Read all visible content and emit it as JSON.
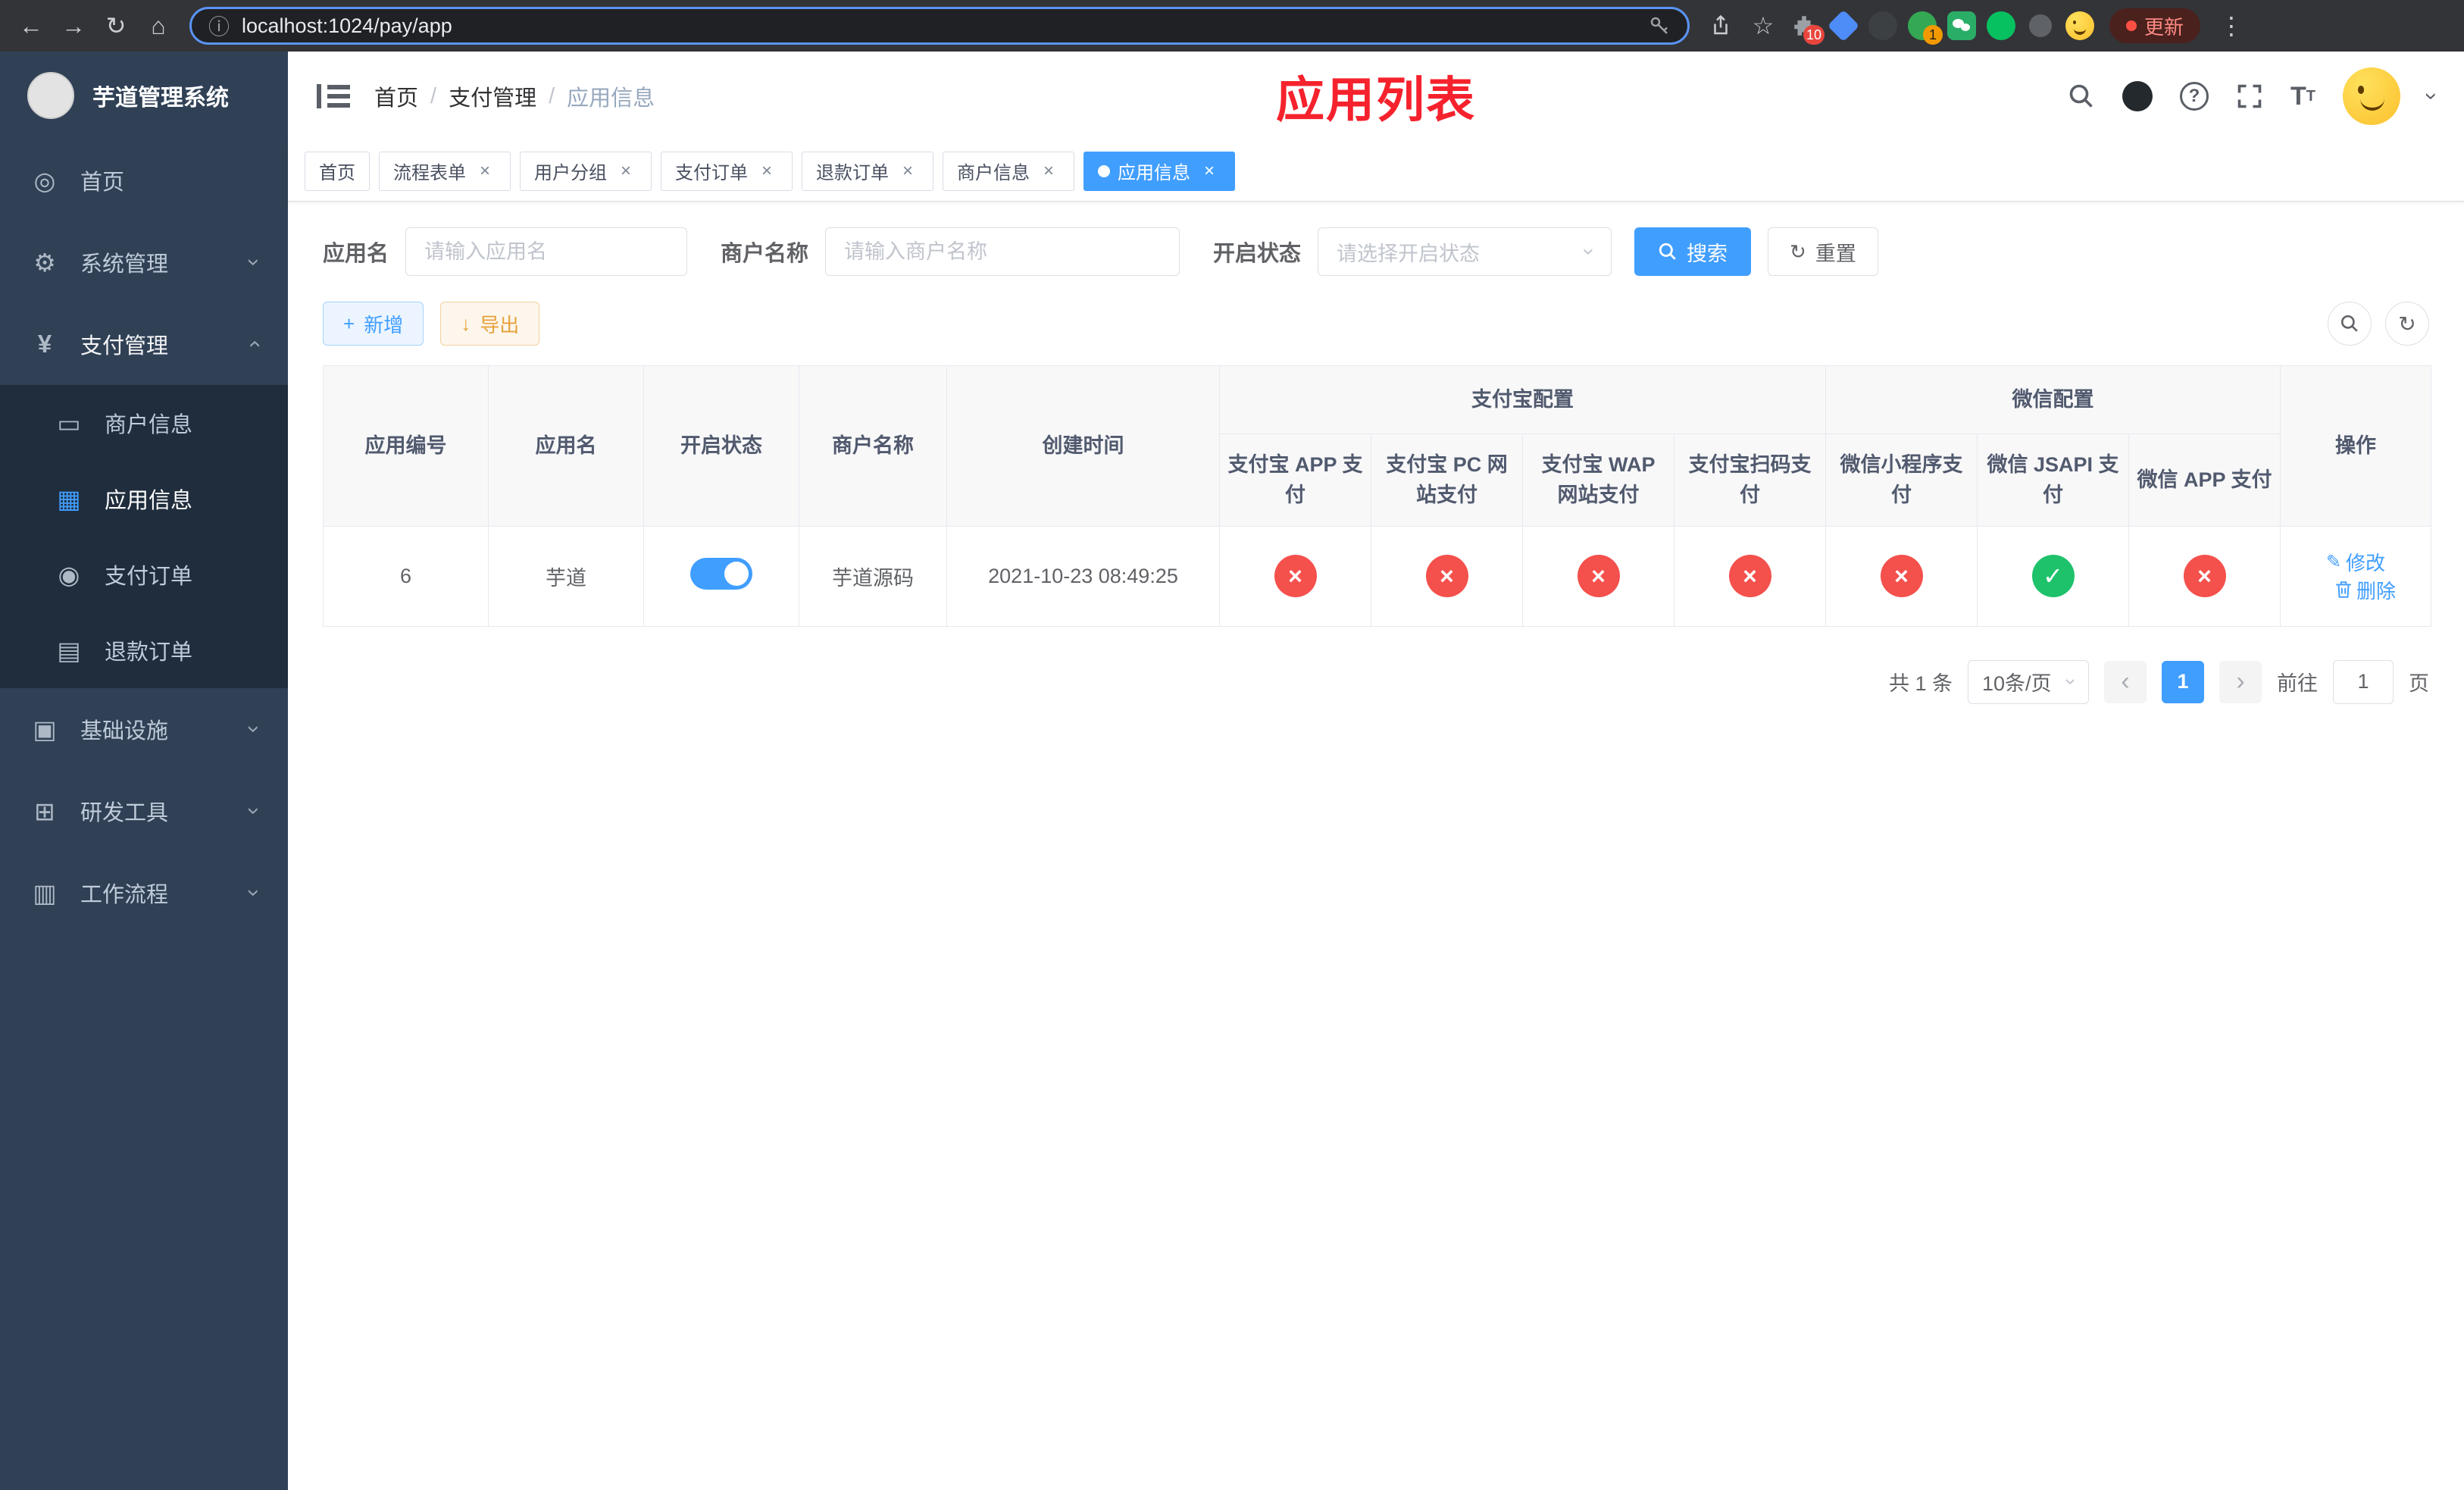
{
  "colors": {
    "accent": "#409eff",
    "danger": "#f4504c",
    "success": "#1ec26b",
    "title_red": "#f5222d"
  },
  "icons": {
    "back": "←",
    "forward": "→",
    "reload": "↻",
    "home": "⌂",
    "info": "ⓘ",
    "star": "☆",
    "kebab": "⋮",
    "plus": "+",
    "download": "↓",
    "refresh": "↻",
    "close": "×",
    "check": "✓",
    "cross": "×",
    "caret": "›",
    "arrow_left": "‹",
    "arrow_right": "›",
    "yen": "¥",
    "gear": "⚙",
    "dashboard": "◎",
    "card": "▭",
    "grid": "▦",
    "order": "◉",
    "doc": "▤",
    "infra": "▣",
    "tool": "⊞",
    "flow": "▥",
    "edit": "✎",
    "help": "?",
    "font_big": "T",
    "font_small": "T"
  },
  "browser": {
    "url": "localhost:1024/pay/app",
    "update_label": "更新",
    "puzzle_badge": "10",
    "green_badge": "1"
  },
  "sidebar": {
    "title": "芋道管理系统",
    "items": [
      {
        "label": "首页"
      },
      {
        "label": "系统管理"
      },
      {
        "label": "支付管理"
      },
      {
        "label": "商户信息"
      },
      {
        "label": "应用信息"
      },
      {
        "label": "支付订单"
      },
      {
        "label": "退款订单"
      },
      {
        "label": "基础设施"
      },
      {
        "label": "研发工具"
      },
      {
        "label": "工作流程"
      }
    ]
  },
  "navbar": {
    "breadcrumb": [
      "首页",
      "支付管理",
      "应用信息"
    ],
    "separator": "/",
    "page_title": "应用列表"
  },
  "tabs": [
    {
      "label": "首页"
    },
    {
      "label": "流程表单"
    },
    {
      "label": "用户分组"
    },
    {
      "label": "支付订单"
    },
    {
      "label": "退款订单"
    },
    {
      "label": "商户信息"
    },
    {
      "label": "应用信息"
    }
  ],
  "filters": {
    "app_name_label": "应用名",
    "app_name_placeholder": "请输入应用名",
    "merchant_label": "商户名称",
    "merchant_placeholder": "请输入商户名称",
    "status_label": "开启状态",
    "status_placeholder": "请选择开启状态",
    "search_label": "搜索",
    "reset_label": "重置"
  },
  "toolbar": {
    "add_label": "新增",
    "export_label": "导出"
  },
  "table": {
    "headers": {
      "app_id": "应用编号",
      "app_name": "应用名",
      "status": "开启状态",
      "merchant": "商户名称",
      "created": "创建时间",
      "alipay_group": "支付宝配置",
      "wechat_group": "微信配置",
      "alipay_app": "支付宝 APP 支付",
      "alipay_pc": "支付宝 PC 网站支付",
      "alipay_wap": "支付宝 WAP 网站支付",
      "alipay_qr": "支付宝扫码支付",
      "wx_lite": "微信小程序支付",
      "wx_jsapi": "微信 JSAPI 支付",
      "wx_app": "微信 APP 支付",
      "ops": "操作"
    },
    "row": {
      "app_id": "6",
      "app_name": "芋道",
      "enabled": true,
      "merchant": "芋道源码",
      "created": "2021-10-23 08:49:25",
      "configs": [
        false,
        false,
        false,
        false,
        false,
        true,
        false
      ],
      "edit_label": "修改",
      "delete_label": "删除"
    }
  },
  "pagination": {
    "total": "共 1 条",
    "page_size": "10条/页",
    "page": "1",
    "goto_prefix": "前往",
    "goto_value": "1",
    "goto_suffix": "页"
  }
}
